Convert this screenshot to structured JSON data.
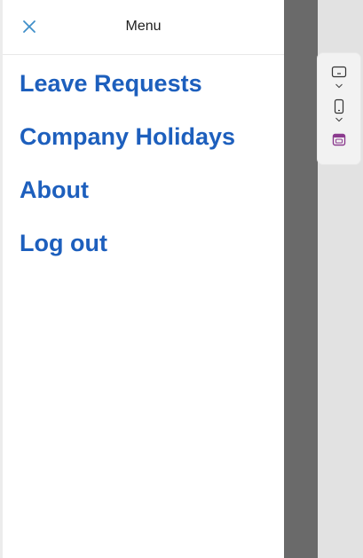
{
  "drawer": {
    "title": "Menu",
    "close_icon": "close-icon",
    "items": [
      {
        "label": "Leave Requests"
      },
      {
        "label": "Company Holidays"
      },
      {
        "label": "About"
      },
      {
        "label": "Log out"
      }
    ]
  },
  "toolbar": {
    "tools": [
      {
        "icon": "desktop-view-icon",
        "dropdown_icon": "chevron-down-icon"
      },
      {
        "icon": "mobile-view-icon",
        "dropdown_icon": "chevron-down-icon"
      },
      {
        "icon": "calendar-app-icon"
      }
    ]
  },
  "colors": {
    "menu_link": "#1d5fbd",
    "close_icon": "#3f8fc9",
    "overlay": "#6a6a6a",
    "app_icon": "#8b3a8e"
  }
}
